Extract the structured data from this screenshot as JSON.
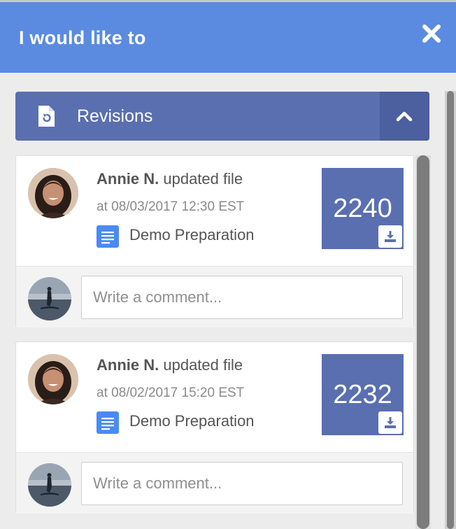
{
  "header": {
    "title": "I would like to",
    "close_icon": "close-icon"
  },
  "section": {
    "title": "Revisions",
    "icon": "revision-file-icon",
    "collapse_icon": "chevron-up-icon"
  },
  "colors": {
    "header": "#5b8be0",
    "section": "#5a6fb0",
    "section_toggle": "#4c5f9e",
    "doc_icon": "#4a8af4"
  },
  "revisions": [
    {
      "user": "Annie N.",
      "action": "updated file",
      "timestamp": "at 08/03/2017 12:30 EST",
      "file_name": "Demo Preparation",
      "revision_number": "2240",
      "comment_placeholder": "Write a comment..."
    },
    {
      "user": "Annie N.",
      "action": "updated file",
      "timestamp": "at 08/02/2017 15:20 EST",
      "file_name": "Demo Preparation",
      "revision_number": "2232",
      "comment_placeholder": "Write a comment..."
    }
  ]
}
